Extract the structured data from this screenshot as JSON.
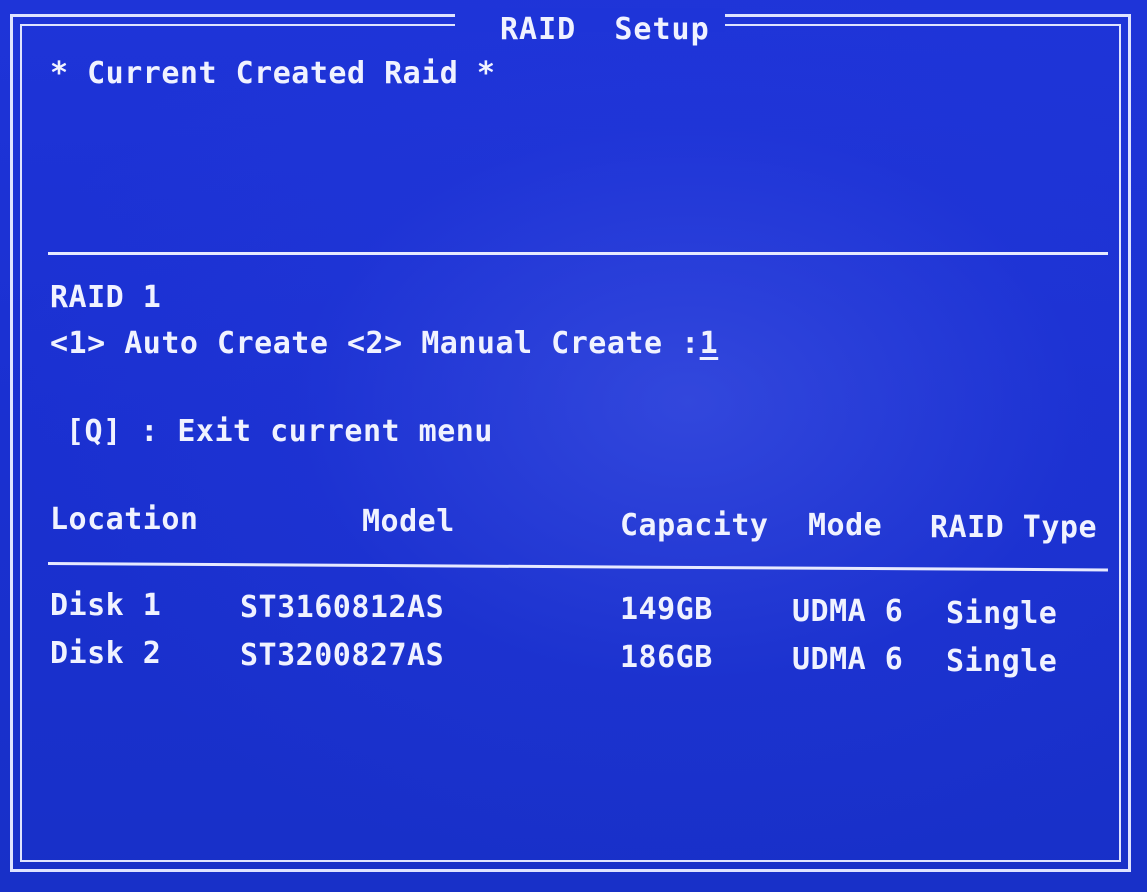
{
  "window": {
    "title": "RAID  Setup"
  },
  "current_section": {
    "heading": "* Current Created Raid *"
  },
  "create_section": {
    "raid_level": "RAID 1",
    "prompt": "<1> Auto Create <2> Manual Create :",
    "prompt_value": "1",
    "exit_hint": "[Q] : Exit current menu"
  },
  "disk_table": {
    "headers": {
      "location": "Location",
      "model": "Model",
      "capacity": "Capacity",
      "mode": "Mode",
      "raid_type": "RAID Type"
    },
    "rows": [
      {
        "location": "Disk 1",
        "model": "ST3160812AS",
        "capacity": "149GB",
        "mode": "UDMA 6",
        "raid_type": "Single"
      },
      {
        "location": "Disk 2",
        "model": "ST3200827AS",
        "capacity": "186GB",
        "mode": "UDMA 6",
        "raid_type": "Single"
      }
    ]
  },
  "colors": {
    "background": "#1e34d8",
    "text": "#f0f2ff",
    "frame": "#dfe3ff"
  }
}
